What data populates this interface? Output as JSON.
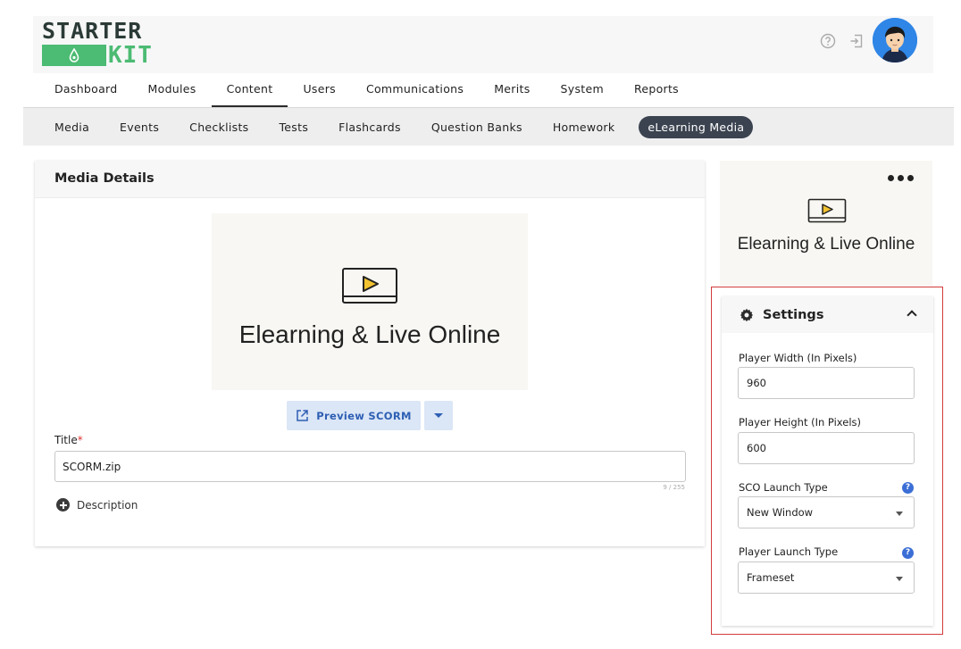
{
  "logo": {
    "top": "STARTER",
    "bottom": "KIT"
  },
  "main_nav": [
    {
      "label": "Dashboard"
    },
    {
      "label": "Modules"
    },
    {
      "label": "Content"
    },
    {
      "label": "Users"
    },
    {
      "label": "Communications"
    },
    {
      "label": "Merits"
    },
    {
      "label": "System"
    },
    {
      "label": "Reports"
    }
  ],
  "sub_nav": [
    {
      "label": "Media"
    },
    {
      "label": "Events"
    },
    {
      "label": "Checklists"
    },
    {
      "label": "Tests"
    },
    {
      "label": "Flashcards"
    },
    {
      "label": "Question Banks"
    },
    {
      "label": "Homework"
    },
    {
      "label": "eLearning Media"
    }
  ],
  "media_details": {
    "heading": "Media Details",
    "thumbnail_text": "Elearning & Live Online",
    "preview_label": "Preview SCORM",
    "title_label": "Title",
    "required_mark": "*",
    "title_value": "SCORM.zip",
    "title_counter": "9 / 255",
    "description_label": "Description"
  },
  "side_thumbnail": {
    "text": "Elearning & Live Online"
  },
  "settings": {
    "heading": "Settings",
    "player_width_label": "Player Width (In Pixels)",
    "player_width_value": "960",
    "player_height_label": "Player Height (In Pixels)",
    "player_height_value": "600",
    "sco_launch_label": "SCO Launch Type",
    "sco_launch_value": "New Window",
    "player_launch_label": "Player Launch Type",
    "player_launch_value": "Frameset",
    "help_glyph": "?"
  },
  "colors": {
    "accent_green": "#4cbb73",
    "active_pill": "#3b4350",
    "preview_blue": "#2e5fb3",
    "highlight_red": "#d23b3b"
  }
}
